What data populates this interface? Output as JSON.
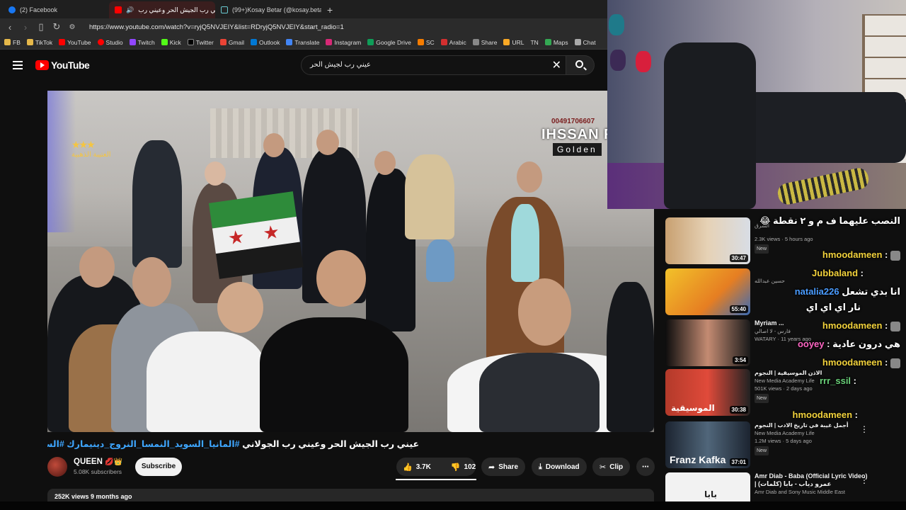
{
  "browser": {
    "tabs": [
      {
        "label": "(2) Facebook",
        "color": "#1877f2"
      },
      {
        "label": "عيني رب الجيش الحر وعيني رب",
        "color": "#ff0000"
      },
      {
        "label": "(99+)Kosay Betar (@kosay.betar) | Ti",
        "color": "#222222"
      }
    ],
    "new_tab": "+",
    "url": "https://www.youtube.com/watch?v=ryjQ5NVJEIY&list=RDryjQ5NVJEIY&start_radio=1",
    "bookmarks": [
      "FB",
      "TikTok",
      "YouTube",
      "Studio",
      "Twitch",
      "Kick",
      "Twitter",
      "Gmail",
      "Outlook",
      "Translate",
      "Instagram",
      "Google Drive",
      "SC",
      "Arabic",
      "Share",
      "URL",
      "TN",
      "Maps",
      "Chat"
    ]
  },
  "youtube": {
    "logo_text": "YouTube",
    "search_value": "عيني رب لجيش الحر"
  },
  "video": {
    "watermark_phone": "00491706607",
    "watermark_brand": "IHSSAN FOTO",
    "watermark_sub": "Golden",
    "badge_text": "العتيبة الذهبية",
    "title_text": "عيني رب الجيش الحر وعيني رب الجولاني",
    "title_tags": "#المانيا_السويد_النمسا_النروج_دينيمارك #السعودية #الامارات",
    "title_emojis": "💚✌"
  },
  "channel": {
    "name": "QUEEN",
    "subscribers": "5.08K subscribers",
    "subscribe_label": "Subscribe",
    "likes": "3.7K",
    "dislikes": "102",
    "share_label": "Share",
    "download_label": "Download",
    "clip_label": "Clip",
    "more_label": "⋯",
    "desc_preview": "252K views  9 months ago"
  },
  "sidebar": [
    {
      "title": "",
      "channel": "الشرق",
      "meta": "2.3K views · 5 hours ago",
      "badge": "New",
      "duration": "30:47"
    },
    {
      "title": "",
      "channel": "حسين عبدالله",
      "meta": "",
      "badge": "",
      "duration": "55:40"
    },
    {
      "title": "Myriam ...",
      "channel": "فارس - لا اصالي",
      "meta": "WATARY · 11 years ago",
      "badge": "",
      "duration": "3:54"
    },
    {
      "title": "الاذن الموسيقية | النجوم",
      "channel": "New Media Academy Life",
      "meta": "501K views · 2 days ago",
      "badge": "New",
      "duration": "30:38"
    },
    {
      "title": "أجمل غيبة في تاريخ الادب | النجوم",
      "channel": "New Media Academy Life",
      "meta": "1.2M views · 5 days ago",
      "badge": "New",
      "duration": "37:01"
    },
    {
      "title": "Amr Diab - Baba (Official Lyric Video) | عمرو دياب - بابا (كلمات)",
      "channel": "Amr Diab and Sony Music Middle East",
      "meta": "",
      "badge": "",
      "duration": ""
    }
  ],
  "thumb_texts": {
    "t4": "الموسيقية",
    "t5": "Franz Kafka",
    "t6": "بابا"
  },
  "chat": [
    {
      "user": "",
      "text": "😂 النصب عليهما ف م و ٢ نقطة"
    },
    {
      "user": "hmoodameen",
      "text": ""
    },
    {
      "user": "Jubbaland",
      "text": ""
    },
    {
      "user": "natalia226",
      "text": "انا بدي تشعل"
    },
    {
      "user": "",
      "text": "نار اي اي اي"
    },
    {
      "user": "hmoodameen",
      "text": ""
    },
    {
      "user": "ooyey",
      "text": "هي درون عادية"
    },
    {
      "user": "hmoodameen",
      "text": ""
    },
    {
      "user": "rrr_ssil",
      "text": ""
    },
    {
      "user": "hmoodameen",
      "text": ""
    }
  ],
  "colors": {
    "accent": "#ff0000",
    "link": "#3ea6ff",
    "bg": "#0f0f0f"
  }
}
